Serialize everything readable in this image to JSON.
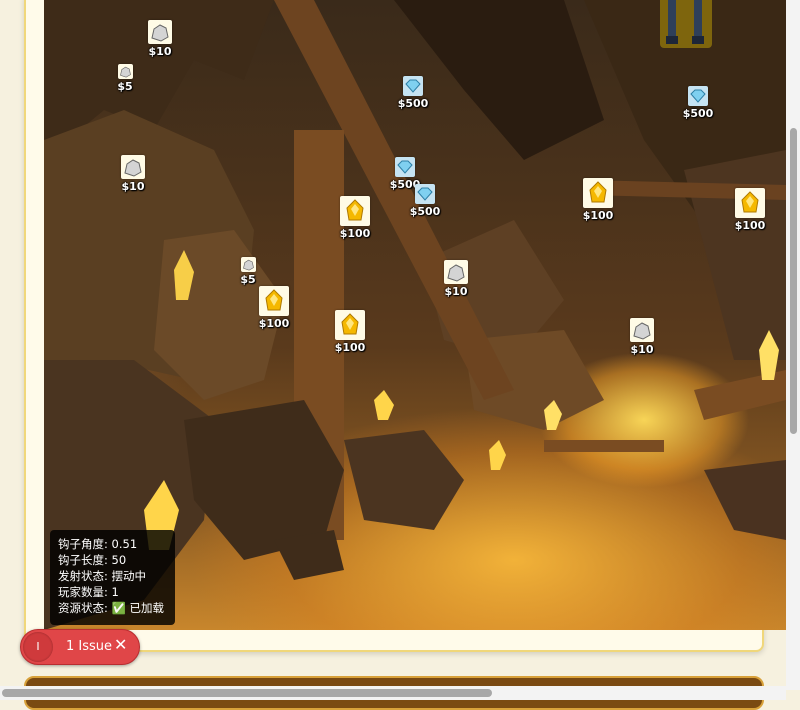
{
  "items": [
    {
      "type": "rock",
      "price": "$10"
    },
    {
      "type": "rock",
      "price": "$5"
    },
    {
      "type": "rock",
      "price": "$10"
    },
    {
      "type": "diamond",
      "price": "$500"
    },
    {
      "type": "diamond",
      "price": "$500"
    },
    {
      "type": "diamond",
      "price": "$500"
    },
    {
      "type": "diamond",
      "price": "$500"
    },
    {
      "type": "gold",
      "price": "$100"
    },
    {
      "type": "rock",
      "price": "$5"
    },
    {
      "type": "gold",
      "price": "$100"
    },
    {
      "type": "rock",
      "price": "$10"
    },
    {
      "type": "gold",
      "price": "$100"
    },
    {
      "type": "gold",
      "price": "$100"
    },
    {
      "type": "gold",
      "price": "$100"
    },
    {
      "type": "rock",
      "price": "$10"
    }
  ],
  "debug": {
    "hook_angle": "钩子角度: 0.51",
    "hook_length": "钩子长度: 50",
    "launch_state": "发射状态: 摆动中",
    "player_count": "玩家数量: 1",
    "asset_state": "资源状态: ✅ 已加载"
  },
  "issue_badge": {
    "avatar_letter": "I",
    "label": "1 Issue",
    "close": "✕"
  },
  "colors": {
    "accent": "#e04648",
    "frame_border": "#f0d77a",
    "gold": "#f5b800",
    "diamond": "#7fd0f0"
  },
  "icons": {
    "rock": "rock-icon",
    "gold": "gold-nugget-icon",
    "diamond": "diamond-icon",
    "hook": "hook-icon"
  }
}
